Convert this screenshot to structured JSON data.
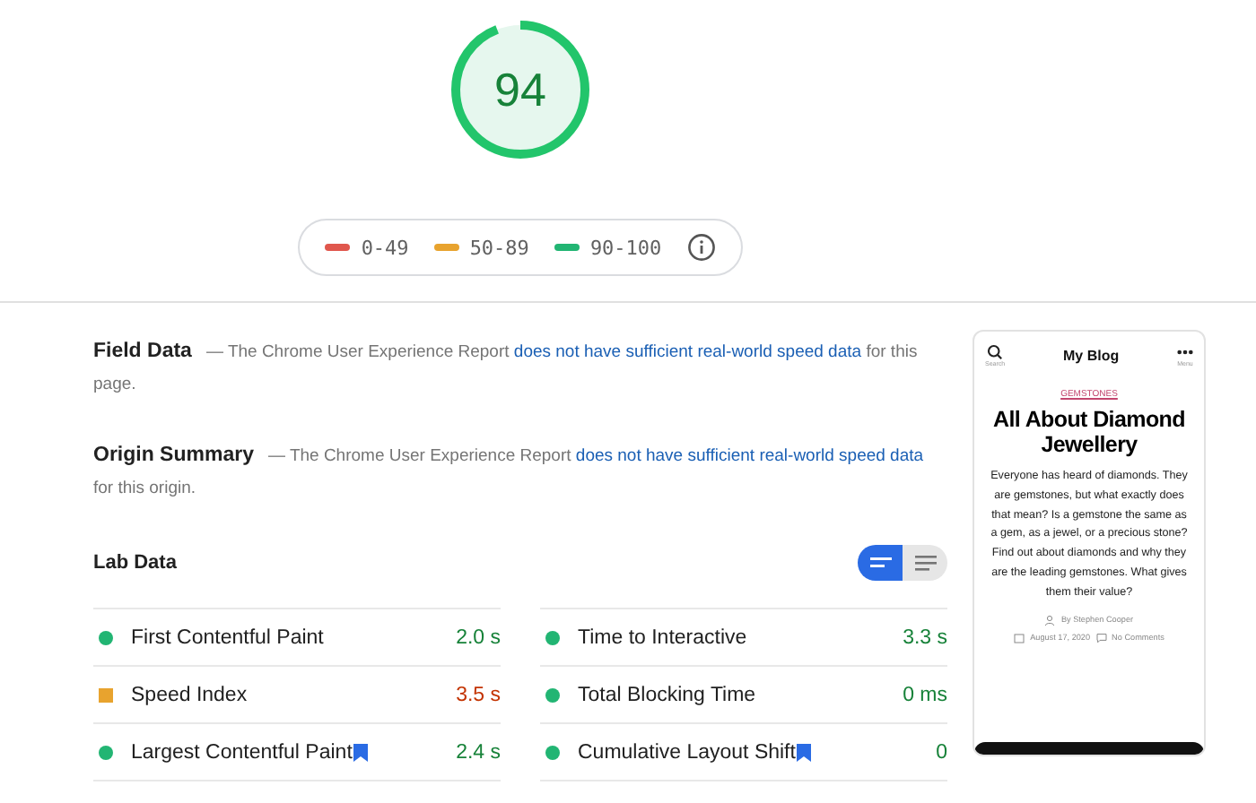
{
  "score": {
    "value": "94",
    "level": 0.94
  },
  "legend": [
    {
      "label": "0-49",
      "color": "#e0574d"
    },
    {
      "label": "50-89",
      "color": "#e8a32e"
    },
    {
      "label": "90-100",
      "color": "#22b573"
    }
  ],
  "field_data": {
    "title": "Field Data",
    "dash": "—",
    "before": "The Chrome User Experience Report",
    "link": "does not have sufficient real-world speed data",
    "after": "for this page."
  },
  "origin_summary": {
    "title": "Origin Summary",
    "dash": "—",
    "before": "The Chrome User Experience Report",
    "link": "does not have sufficient real-world speed data",
    "after": "for this origin."
  },
  "lab_data": {
    "title": "Lab Data",
    "view_toggle": [
      {
        "kind": "compact",
        "selected": true
      },
      {
        "kind": "list",
        "selected": false
      }
    ],
    "metrics": [
      {
        "label": "First Contentful Paint",
        "value": "2.0 s",
        "kind": "pass",
        "flagged": false
      },
      {
        "label": "Time to Interactive",
        "value": "3.3 s",
        "kind": "pass",
        "flagged": false
      },
      {
        "label": "Speed Index",
        "value": "3.5 s",
        "kind": "average",
        "flagged": false
      },
      {
        "label": "Total Blocking Time",
        "value": "0 ms",
        "kind": "pass",
        "flagged": false
      },
      {
        "label": "Largest Contentful Paint",
        "value": "2.4 s",
        "kind": "pass",
        "flagged": true
      },
      {
        "label": "Cumulative Layout Shift",
        "value": "0",
        "kind": "pass",
        "flagged": true
      }
    ]
  },
  "thumbnail": {
    "site_title": "My Blog",
    "search_label": "Search",
    "menu_label": "Menu",
    "category": "GEMSTONES",
    "headline": "All About Diamond Jewellery",
    "excerpt": "Everyone has heard of diamonds. They are gemstones, but what exactly does that mean? Is a gemstone the same as a gem, as a jewel, or a precious stone? Find out about diamonds and why they are the leading gemstones. What gives them their value?",
    "author": "By Stephen Cooper",
    "date": "August 17, 2020",
    "comments": "No Comments"
  }
}
